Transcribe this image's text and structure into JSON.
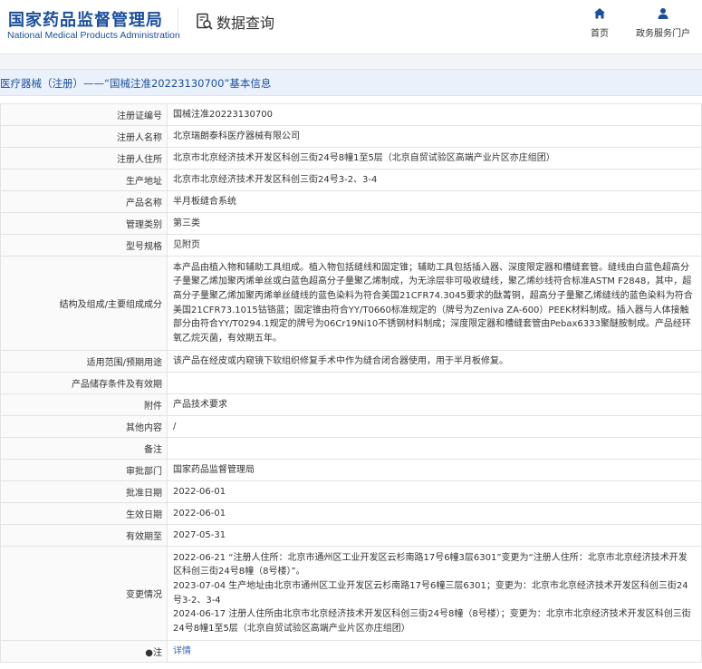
{
  "header": {
    "logo_cn": "国家药品监督管理局",
    "logo_en": "National Medical Products Administration",
    "page_heading": "数据查询",
    "nav": [
      {
        "label": "首页",
        "icon": "home-icon"
      },
      {
        "label": "政务服务门户",
        "icon": "user-icon"
      }
    ]
  },
  "breadcrumb": "医疗器械（注册）——“国械注准20223130700”基本信息",
  "fields": [
    {
      "key": "注册证编号",
      "value": "国械注准20223130700"
    },
    {
      "key": "注册人名称",
      "value": "北京瑞朗泰科医疗器械有限公司"
    },
    {
      "key": "注册人住所",
      "value": "北京市北京经济技术开发区科创三街24号8幢1至5层（北京自贸试验区高端产业片区亦庄组团）"
    },
    {
      "key": "生产地址",
      "value": "北京市北京经济技术开发区科创三街24号3-2、3-4"
    },
    {
      "key": "产品名称",
      "value": "半月板缝合系统"
    },
    {
      "key": "管理类别",
      "value": "第三类"
    },
    {
      "key": "型号规格",
      "value": "见附页"
    },
    {
      "key": "结构及组成/主要组成成分",
      "value": "本产品由植入物和辅助工具组成。植入物包括缝线和固定锥；辅助工具包括插入器、深度限定器和槽缝套管。缝线由白蓝色超高分子量聚乙烯加聚丙烯单丝或白蓝色超高分子量聚乙烯制成，为无涂层非可吸收缝线，聚乙烯纱线符合标准ASTM F2848，其中，超高分子量聚乙烯加聚丙烯单丝缝线的蓝色染料为符合美国21CFR74.3045要求的酞菁铜，超高分子量聚乙烯缝线的蓝色染料为符合美国21CFR73.1015钴铬蓝；固定锥由符合YY/T0660标准规定的（牌号为Zeniva ZA-600）PEEK材料制成。插入器与人体接触部分由符合YY/T0294.1规定的牌号为06Cr19Ni10不锈钢材料制成；深度限定器和槽缝套管由Pebax6333聚醚胺制成。产品经环氧乙烷灭菌，有效期五年。"
    },
    {
      "key": "适用范围/预期用途",
      "value": "该产品在经皮或内窥镜下软组织修复手术中作为缝合闭合器使用，用于半月板修复。"
    },
    {
      "key": "产品储存条件及有效期",
      "value": ""
    },
    {
      "key": "附件",
      "value": "产品技术要求"
    },
    {
      "key": "其他内容",
      "value": "/"
    },
    {
      "key": "备注",
      "value": ""
    },
    {
      "key": "审批部门",
      "value": "国家药品监督管理局"
    },
    {
      "key": "批准日期",
      "value": "2022-06-01"
    },
    {
      "key": "生效日期",
      "value": "2022-06-01"
    },
    {
      "key": "有效期至",
      "value": "2027-05-31"
    }
  ],
  "changes": {
    "key": "变更情况",
    "items": [
      "2022-06-21 “注册人住所：北京市通州区工业开发区云杉南路17号6幢3层6301”变更为“注册人住所：北京市北京经济技术开发区科创三街24号8幢（8号楼）”。",
      "2023-07-04 生产地址由北京市通州区工业开发区云杉南路17号6幢三层6301；变更为：北京市北京经济技术开发区科创三街24号3-2、3-4",
      "2024-06-17 注册人住所由北京市北京经济技术开发区科创三街24号8幢（8号楼）；变更为：北京市北京经济技术开发区科创三街24号8幢1至5层（北京自贸试验区高端产业片区亦庄组团）"
    ]
  },
  "note": {
    "key": "●注",
    "link": "详情"
  }
}
